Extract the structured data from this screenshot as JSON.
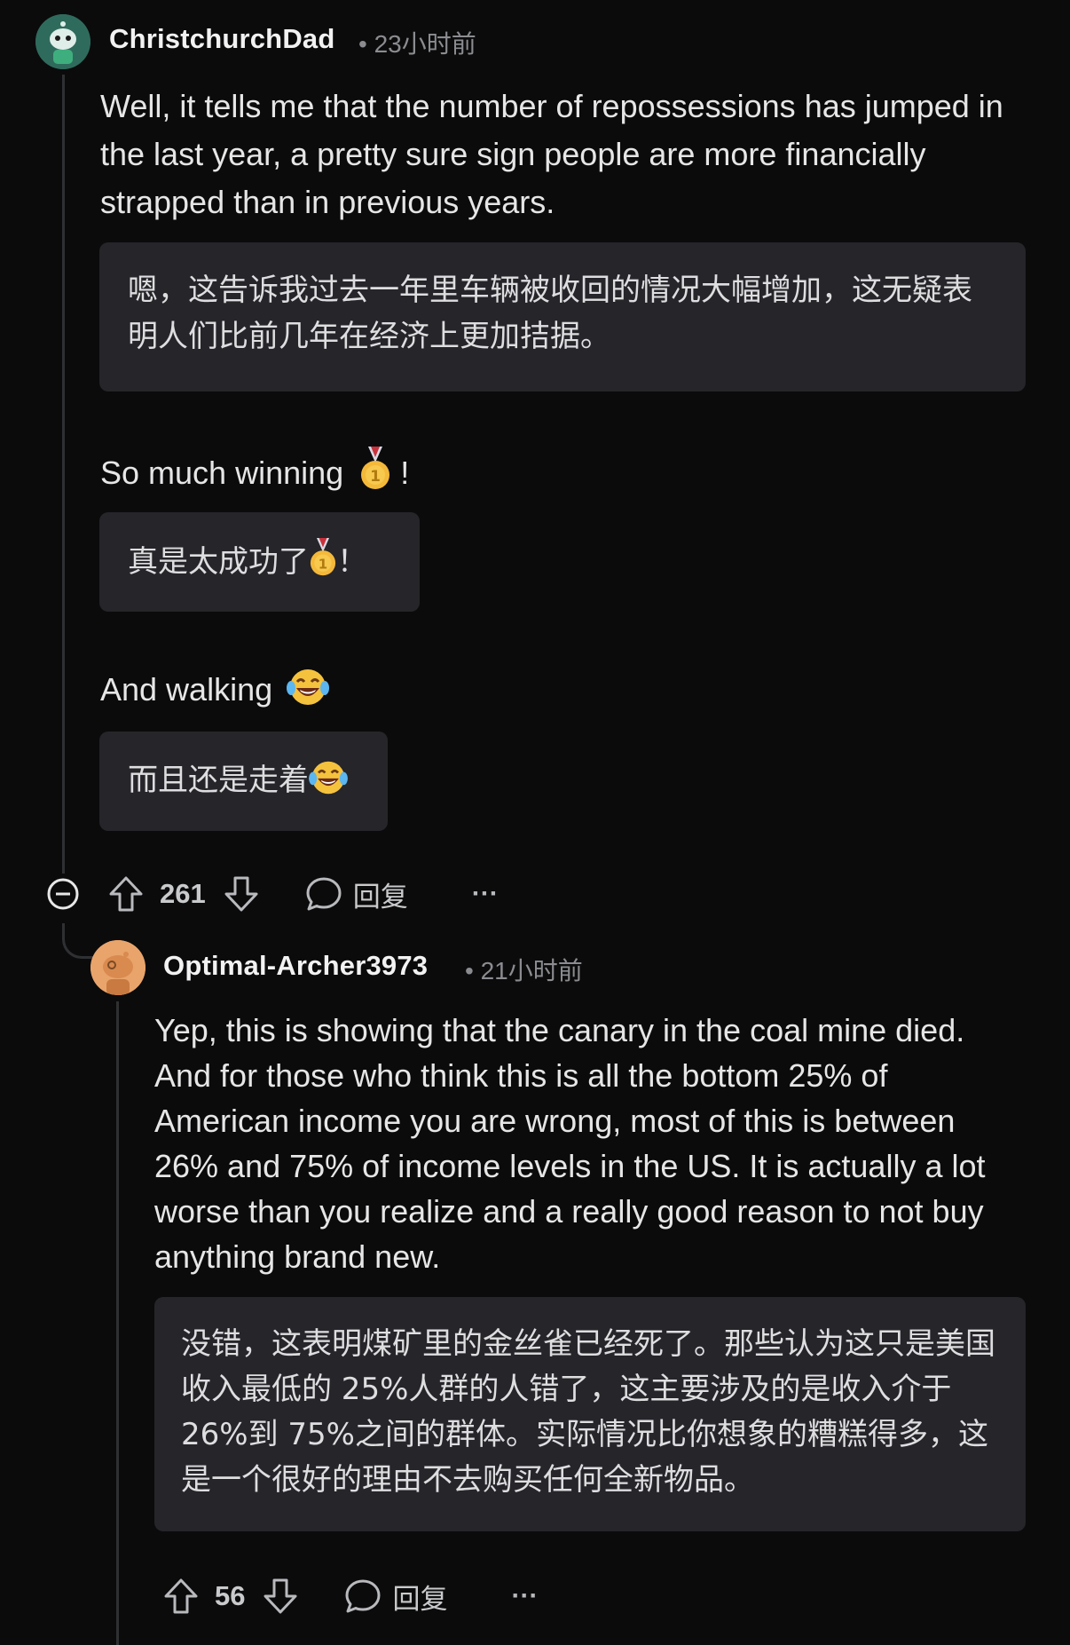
{
  "comment1": {
    "username": "ChristchurchDad",
    "time": "23小时前",
    "paragraphs": [
      {
        "text": "Well, it tells me that the number of repossessions has jumped in the last year, a pretty sure sign people are more financially strapped than in previous years.",
        "translation": "嗯，这告诉我过去一年里车辆被收回的情况大幅增加，这无疑表明人们比前几年在经济上更加拮据。"
      },
      {
        "text": "So much winning",
        "text_end": "!",
        "translation": "真是太成功了",
        "translation_end": "！"
      },
      {
        "text": "And walking",
        "translation": "而且还是走着"
      }
    ],
    "votes": "261",
    "reply_label": "回复",
    "more": "···"
  },
  "comment2": {
    "username": "Optimal-Archer3973",
    "time": "21小时前",
    "text": "Yep, this is showing that the canary in the coal mine died. And for those who think this is all the bottom 25% of American income you are wrong, most of this is between 26% and 75% of income levels in the US. It is actually a lot worse than you realize and a really good reason to not buy anything brand new.",
    "translation": "没错，这表明煤矿里的金丝雀已经死了。那些认为这只是美国收入最低的 25%人群的人错了，这主要涉及的是收入介于 26%到 75%之间的群体。实际情况比你想象的糟糕得多，这是一个很好的理由不去购买任何全新物品。",
    "votes": "56",
    "reply_label": "回复",
    "more": "···"
  },
  "colors": {
    "background": "#0b0b0c",
    "translation_box": "#25252a",
    "thread_line": "#2f3033",
    "avatar1_bg": "#2f6b5c",
    "avatar2_bg": "#e9a46b"
  }
}
